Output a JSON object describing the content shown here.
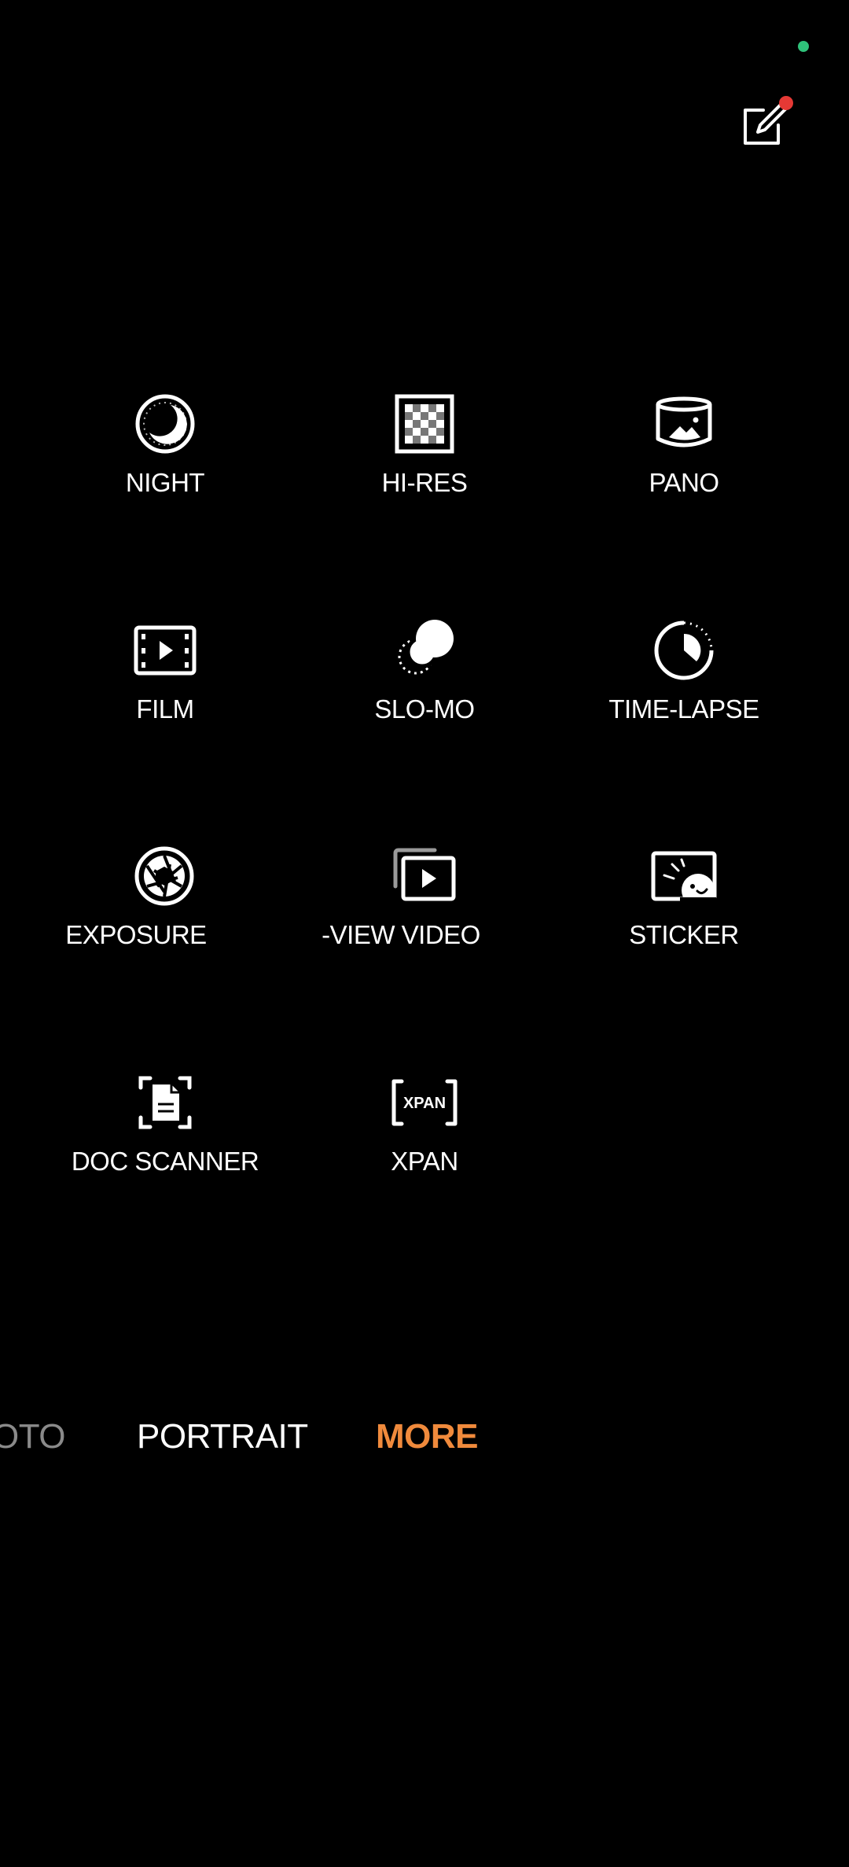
{
  "status": {
    "privacy_dot_color": "#2fc27a"
  },
  "toolbar": {
    "edit_icon": "edit-pencil-icon",
    "badge_color": "#e53935"
  },
  "modes": [
    {
      "label": "NIGHT",
      "icon": "night-moon-icon"
    },
    {
      "label": "HI-RES",
      "icon": "hi-res-checker-icon"
    },
    {
      "label": "PANO",
      "icon": "pano-icon"
    },
    {
      "label": "FILM",
      "icon": "film-icon"
    },
    {
      "label": "SLO-MO",
      "icon": "slo-mo-icon"
    },
    {
      "label": "TIME-LAPSE",
      "icon": "time-lapse-icon"
    },
    {
      "label": "EXPOSURE",
      "icon": "aperture-icon"
    },
    {
      "label": "-VIEW VIDEO",
      "icon": "dual-view-video-icon"
    },
    {
      "label": "STICKER",
      "icon": "sticker-icon"
    },
    {
      "label": "DOC SCANNER",
      "icon": "doc-scanner-icon"
    },
    {
      "label": "XPAN",
      "icon": "xpan-icon",
      "icon_text": "XPAN"
    }
  ],
  "mode_bar": {
    "tabs": [
      {
        "label": "OTO",
        "state": "faded"
      },
      {
        "label": "PORTRAIT",
        "state": "normal"
      },
      {
        "label": "MORE",
        "state": "active"
      }
    ],
    "active_color": "#f08a3c",
    "faded_color": "#8a8a8a"
  }
}
